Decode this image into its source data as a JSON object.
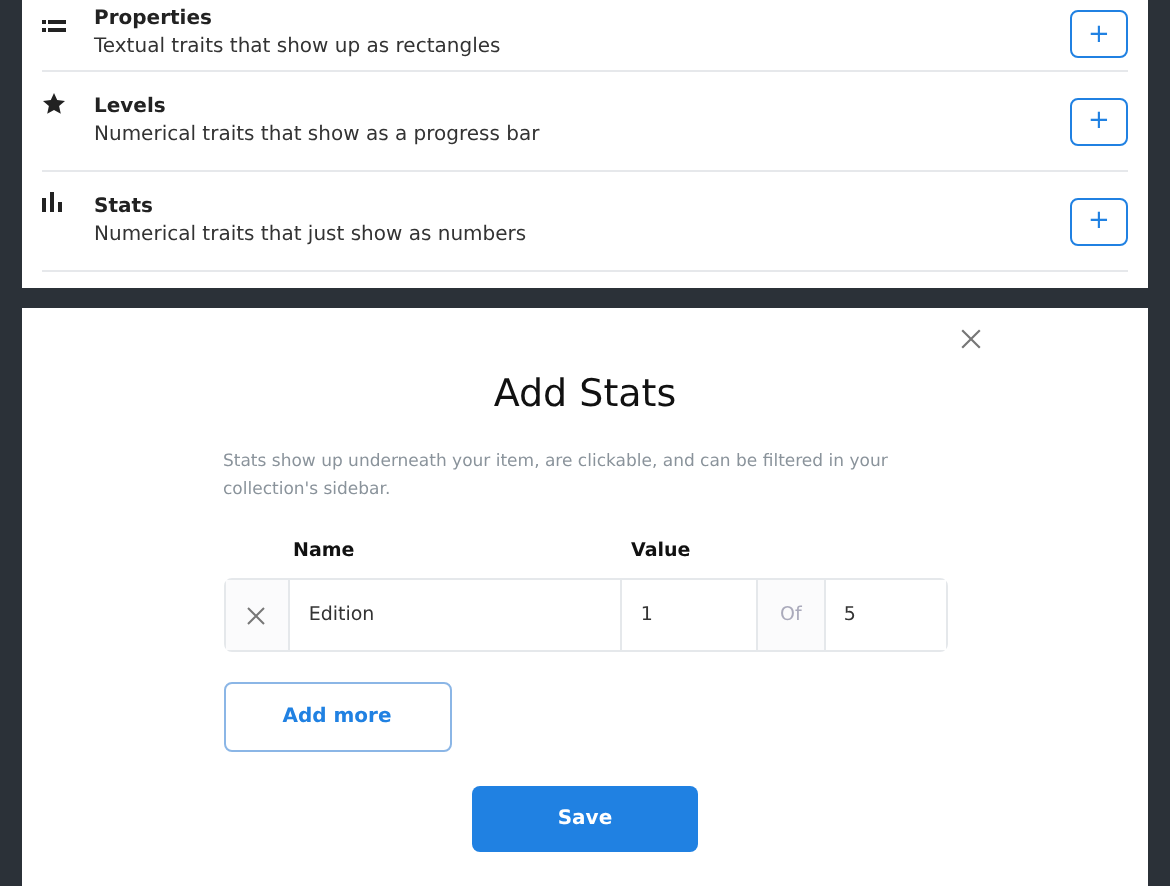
{
  "trait_types": [
    {
      "kind": "list",
      "title": "Properties",
      "description": "Textual traits that show up as rectangles",
      "add_label": "+"
    },
    {
      "kind": "star",
      "title": "Levels",
      "description": "Numerical traits that show as a progress bar",
      "add_label": "+"
    },
    {
      "kind": "bars",
      "title": "Stats",
      "description": "Numerical traits that just show as numbers",
      "add_label": "+"
    }
  ],
  "dialog": {
    "title": "Add Stats",
    "description": "Stats show up underneath your item, are clickable, and can be filtered in your collection's sidebar.",
    "columns": [
      "Name",
      "Value"
    ],
    "rows": [
      {
        "name": "Edition",
        "value": "1",
        "of_label": "Of",
        "max": "5"
      }
    ],
    "add_more": "Add more",
    "save": "Save"
  }
}
